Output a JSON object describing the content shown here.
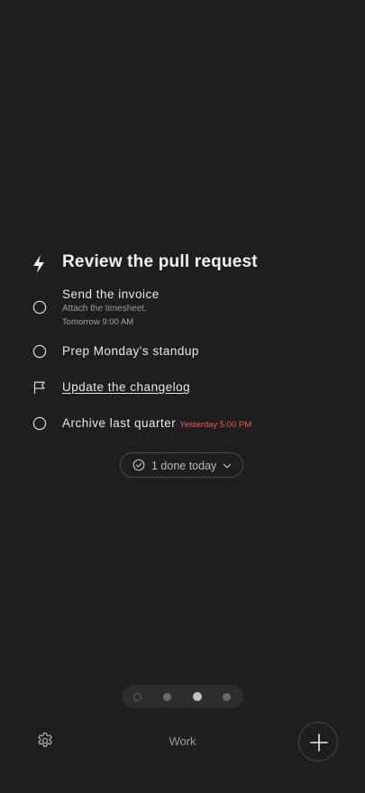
{
  "hero": {
    "title": "Review the pull request",
    "icon": "bolt-icon"
  },
  "tasks": [
    {
      "label": "Send the invoice",
      "note": "Attach the timesheet.",
      "due": "Tomorrow 9:00 AM",
      "icon": "circle-icon"
    },
    {
      "label": "Prep Monday's standup",
      "icon": "circle-icon"
    },
    {
      "label": "Update the changelog",
      "icon": "flag-icon"
    },
    {
      "label": "Archive last quarter",
      "due": "Yesterday 5:00 PM",
      "due_color": "#e0605a",
      "icon": "circle-icon"
    }
  ],
  "done_pill": {
    "label": "1 done today"
  },
  "pager": {
    "pages": 4,
    "active": 3
  },
  "footer": {
    "list_name": "Work"
  }
}
